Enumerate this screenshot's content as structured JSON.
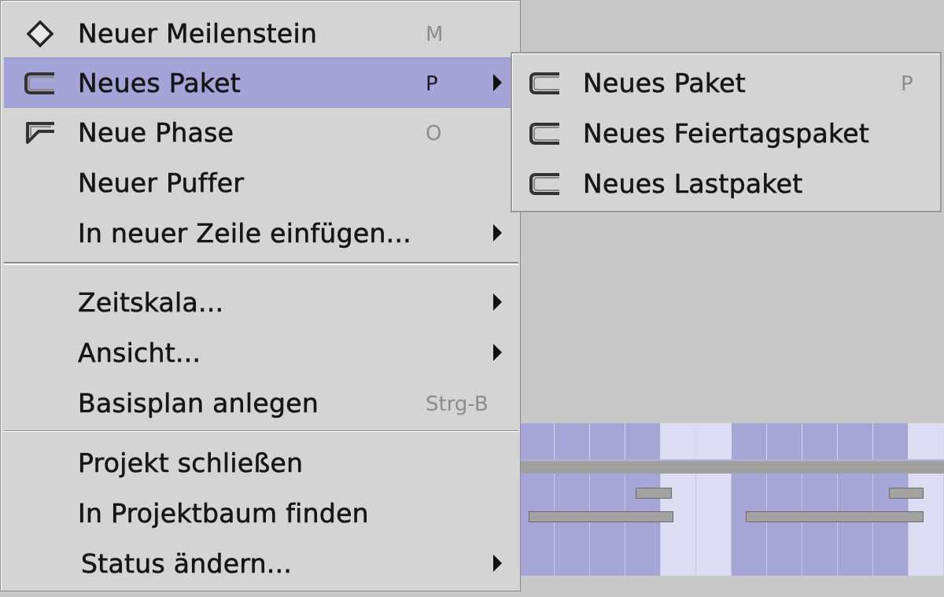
{
  "main_menu": {
    "items": [
      {
        "label": "Neuer Meilenstein",
        "shortcut": "M",
        "icon": "milestone-diamond-icon"
      },
      {
        "label": "Neues Paket",
        "shortcut": "P",
        "icon": "package-bracket-icon",
        "submenu": true,
        "selected": true
      },
      {
        "label": "Neue Phase",
        "shortcut": "O",
        "icon": "phase-bracket-icon"
      },
      {
        "label": "Neuer Puffer"
      },
      {
        "label": "In neuer Zeile einfügen...",
        "submenu": true
      },
      {
        "label": "Zeitskala...",
        "submenu": true
      },
      {
        "label": "Ansicht...",
        "submenu": true
      },
      {
        "label": "Basisplan anlegen",
        "shortcut": "Strg-B"
      },
      {
        "label": "Projekt schließen"
      },
      {
        "label": "In Projektbaum finden"
      },
      {
        "label": "Status ändern...",
        "submenu": true
      }
    ]
  },
  "sub_menu": {
    "items": [
      {
        "label": "Neues Paket",
        "shortcut": "P",
        "icon": "package-bracket-icon"
      },
      {
        "label": "Neues Feiertagspaket",
        "icon": "package-bracket-icon"
      },
      {
        "label": "Neues Lastpaket",
        "icon": "package-bracket-icon"
      }
    ]
  },
  "colors": {
    "menu_bg": "#d4d4d4",
    "selection": "#a4a4d8",
    "shortcut_text": "#8c8c8c",
    "gantt_bg": "#a6a6d6",
    "gantt_weekend": "#dcdcf2"
  }
}
